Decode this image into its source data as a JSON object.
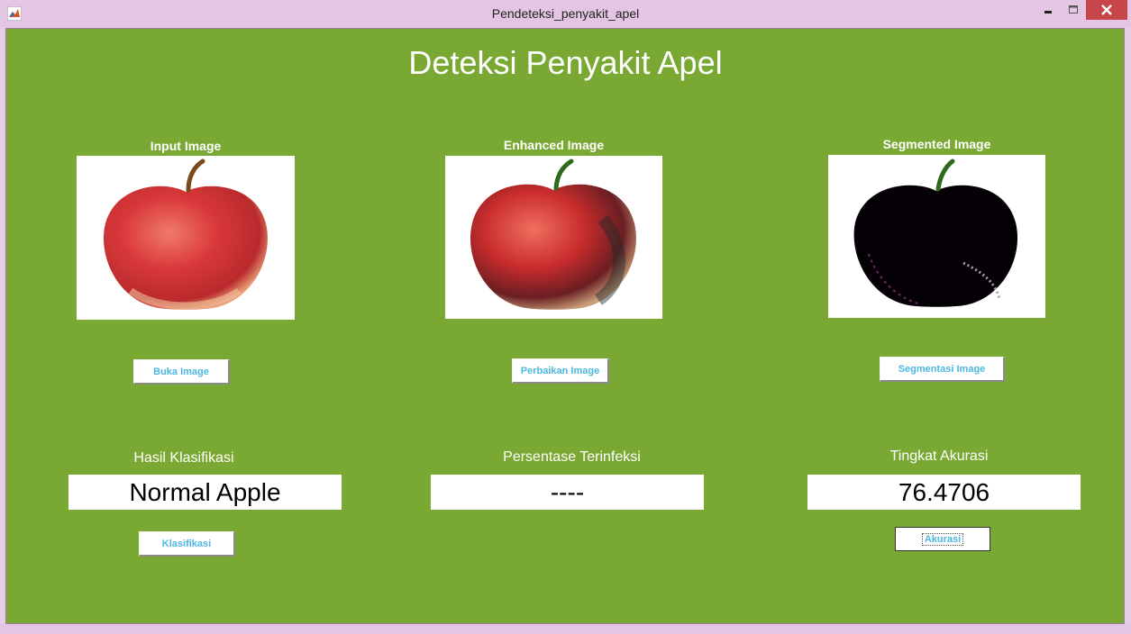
{
  "window": {
    "title": "Pendeteksi_penyakit_apel",
    "icon": "matlab-icon",
    "controls": {
      "minimize": "minimize-icon",
      "maximize": "maximize-icon",
      "close": "close-icon"
    }
  },
  "heading": "Deteksi Penyakit Apel",
  "colors": {
    "background": "#7aa933",
    "button_text": "#4bb7e2",
    "titlebar": "#e4c6e4",
    "close": "#c7464a"
  },
  "panels": {
    "input": {
      "label": "Input Image",
      "button": "Buka Image"
    },
    "enhanced": {
      "label": "Enhanced Image",
      "button": "Perbaikan Image"
    },
    "segmented": {
      "label": "Segmented Image",
      "button": "Segmentasi Image"
    }
  },
  "results": {
    "classification": {
      "label": "Hasil Klasifikasi",
      "value": "Normal Apple",
      "button": "Klasifikasi"
    },
    "infection": {
      "label": "Persentase Terinfeksi",
      "value": "----"
    },
    "accuracy": {
      "label": "Tingkat Akurasi",
      "value": "76.4706",
      "button": "Akurasi"
    }
  }
}
